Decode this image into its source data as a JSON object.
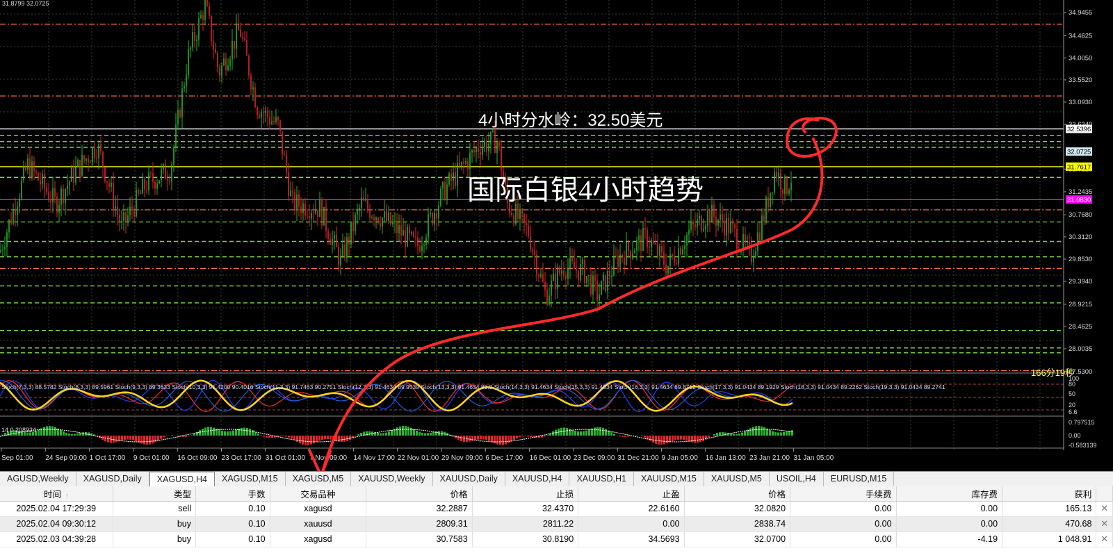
{
  "top_readout": "31.8799 32.0725",
  "annotations": {
    "watershed": "4小时分水岭：32.50美元",
    "trend_title": "国际白银4小时趋势"
  },
  "countdown": "166分19秒",
  "price_axis": {
    "ticks": [
      "34.9455",
      "34.4625",
      "34.0050",
      "33.5520",
      "33.0930",
      "32.6340",
      "31.7120",
      "31.2435",
      "30.7680",
      "30.3120",
      "29.8530",
      "29.3940",
      "28.9215",
      "28.4625",
      "28.0035",
      "27.5300"
    ],
    "tags": [
      {
        "label": "32.5396",
        "bg": "#ffffff",
        "fg": "#000000"
      },
      {
        "label": "32.0725",
        "bg": "#cfe7f2",
        "fg": "#000000"
      },
      {
        "label": "31.7617",
        "bg": "#ffff00",
        "fg": "#000000"
      },
      {
        "label": "31.0830",
        "bg": "#ff00ff",
        "fg": "#ffffff"
      }
    ]
  },
  "stoch": {
    "labels": [
      "Stoch(7,3,3) 88.5782",
      "Stoch(8,3,3) 89.5961",
      "Stoch(9,3,3) 89.3633",
      "Stoch(10,3,3) 91.4200 90.4016",
      "Stoch(11,3,3) 91.7463 90.2751",
      "Stoch(12,3,3) 91.4634 89.9539",
      "Stoch(13,3,3) 91.4634 89.9",
      "Stoch(14,3,3) 91.4634",
      "Stoch(15,3,3) 91.4634",
      "Stoch(16,3,3) 91.4634 89.8712",
      "Stoch(17,3,3) 91.0434 89.1929",
      "Stoch(18,3,3) 91.0434 89.2262",
      "Stoch(19,3,3) 91.0434 89.2741"
    ],
    "axis": [
      "100",
      "80",
      "50",
      "20",
      "6.6"
    ]
  },
  "macd": {
    "label": "14 0.208924",
    "axis": [
      "0.797515",
      "0.00",
      "-0.583139"
    ]
  },
  "time_axis": [
    "Sep 01:00",
    "24 Sep 09:00",
    "1 Oct 17:00",
    "9 Oct 01:00",
    "16 Oct 09:00",
    "23 Oct 17:00",
    "31 Oct 01:00",
    "7 Nov 09:00",
    "14 Nov 17:00",
    "22 Nov 01:00",
    "29 Nov 09:00",
    "6 Dec 17:00",
    "16 Dec 01:00",
    "23 Dec 09:00",
    "31 Dec 21:00",
    "9 Jan 05:00",
    "16 Jan 13:00",
    "23 Jan 21:00",
    "31 Jan 05:00"
  ],
  "chart_tabs": [
    "AGUSD,Weekly",
    "XAGUSD,Daily",
    "XAGUSD,H4",
    "XAGUSD,M15",
    "XAGUSD,M5",
    "XAUUSD,Weekly",
    "XAUUSD,Daily",
    "XAUUSD,H4",
    "XAUUSD,H1",
    "XAUUSD,M15",
    "XAUUSD,M5",
    "USOIL,H4",
    "EURUSD,M15"
  ],
  "active_tab": "XAGUSD,H4",
  "trades": {
    "columns": [
      "时间",
      "类型",
      "手数",
      "交易品种",
      "价格",
      "止损",
      "止盈",
      "价格",
      "手续费",
      "库存费",
      "获利"
    ],
    "rows": [
      [
        "2025.02.04 17:29:39",
        "sell",
        "0.10",
        "xagusd",
        "32.2887",
        "32.4370",
        "22.6160",
        "32.0820",
        "0.00",
        "0.00",
        "165.13"
      ],
      [
        "2025.02.04 09:30:12",
        "buy",
        "0.10",
        "xauusd",
        "2809.31",
        "2811.22",
        "0.00",
        "2838.74",
        "0.00",
        "0.00",
        "470.68"
      ],
      [
        "2025.02.03 04:39:28",
        "buy",
        "0.10",
        "xagusd",
        "30.7583",
        "30.8190",
        "34.5693",
        "32.0700",
        "0.00",
        "-4.19",
        "1 048.91"
      ]
    ],
    "close_glyph": "✕",
    "sort_glyph": "↑"
  },
  "chart_data": {
    "type": "candlestick",
    "symbol_timeframe": "XAGUSD,H4",
    "y_range": [
      27.53,
      35.2
    ],
    "level_lines": [
      {
        "price": 34.7,
        "color": "#ff6a4d",
        "style": "dash-dot"
      },
      {
        "price": 33.22,
        "color": "#ff6a4d",
        "style": "dash-dot"
      },
      {
        "price": 32.54,
        "color": "#ffffff",
        "style": "solid"
      },
      {
        "price": 32.4,
        "color": "#7fdc3a",
        "style": "dash"
      },
      {
        "price": 32.28,
        "color": "#7fdc3a",
        "style": "dash"
      },
      {
        "price": 32.16,
        "color": "#7fdc3a",
        "style": "dash"
      },
      {
        "price": 31.76,
        "color": "#ffff00",
        "style": "solid"
      },
      {
        "price": 31.54,
        "color": "#7fdc3a",
        "style": "dash"
      },
      {
        "price": 31.08,
        "color": "#ff00ff",
        "style": "solid"
      },
      {
        "price": 30.87,
        "color": "#ff6a4d",
        "style": "dash-dot"
      },
      {
        "price": 30.62,
        "color": "#7fdc3a",
        "style": "dash"
      },
      {
        "price": 30.22,
        "color": "#7fdc3a",
        "style": "dash"
      },
      {
        "price": 29.9,
        "color": "#7fdc3a",
        "style": "dash"
      },
      {
        "price": 29.66,
        "color": "#ff6a4d",
        "style": "dash-dot"
      },
      {
        "price": 29.3,
        "color": "#7fdc3a",
        "style": "dash"
      },
      {
        "price": 28.95,
        "color": "#7fdc3a",
        "style": "dash"
      },
      {
        "price": 28.38,
        "color": "#7fdc3a",
        "style": "dash"
      },
      {
        "price": 28.02,
        "color": "#7fdc3a",
        "style": "dash"
      },
      {
        "price": 27.92,
        "color": "#7fdc3a",
        "style": "dash"
      },
      {
        "price": 27.55,
        "color": "#ff6a4d",
        "style": "dash-dot"
      }
    ],
    "price_path": [
      [
        0,
        30.0
      ],
      [
        40,
        31.8
      ],
      [
        80,
        31.0
      ],
      [
        110,
        31.7
      ],
      [
        140,
        32.2
      ],
      [
        175,
        30.5
      ],
      [
        210,
        31.4
      ],
      [
        245,
        31.7
      ],
      [
        270,
        34.0
      ],
      [
        295,
        35.1
      ],
      [
        315,
        33.7
      ],
      [
        345,
        34.6
      ],
      [
        370,
        33.0
      ],
      [
        400,
        32.6
      ],
      [
        420,
        31.0
      ],
      [
        460,
        30.9
      ],
      [
        490,
        29.8
      ],
      [
        520,
        31.0
      ],
      [
        560,
        30.6
      ],
      [
        600,
        30.1
      ],
      [
        640,
        31.3
      ],
      [
        690,
        32.2
      ],
      [
        715,
        32.3
      ],
      [
        730,
        31.0
      ],
      [
        760,
        30.4
      ],
      [
        785,
        29.1
      ],
      [
        810,
        29.7
      ],
      [
        840,
        29.6
      ],
      [
        860,
        29.1
      ],
      [
        890,
        29.9
      ],
      [
        930,
        30.3
      ],
      [
        960,
        29.7
      ],
      [
        990,
        30.4
      ],
      [
        1020,
        30.8
      ],
      [
        1050,
        30.5
      ],
      [
        1080,
        29.9
      ],
      [
        1100,
        30.8
      ],
      [
        1115,
        31.7
      ],
      [
        1130,
        31.3
      ],
      [
        1140,
        31.6
      ]
    ]
  },
  "colors": {
    "background": "#000000",
    "grid": "#2c4a2c",
    "candle_bull": "#27b52a",
    "candle_bear": "#e0252a",
    "annotation_red": "#ff2a2a",
    "countdown": "#ffff66"
  }
}
